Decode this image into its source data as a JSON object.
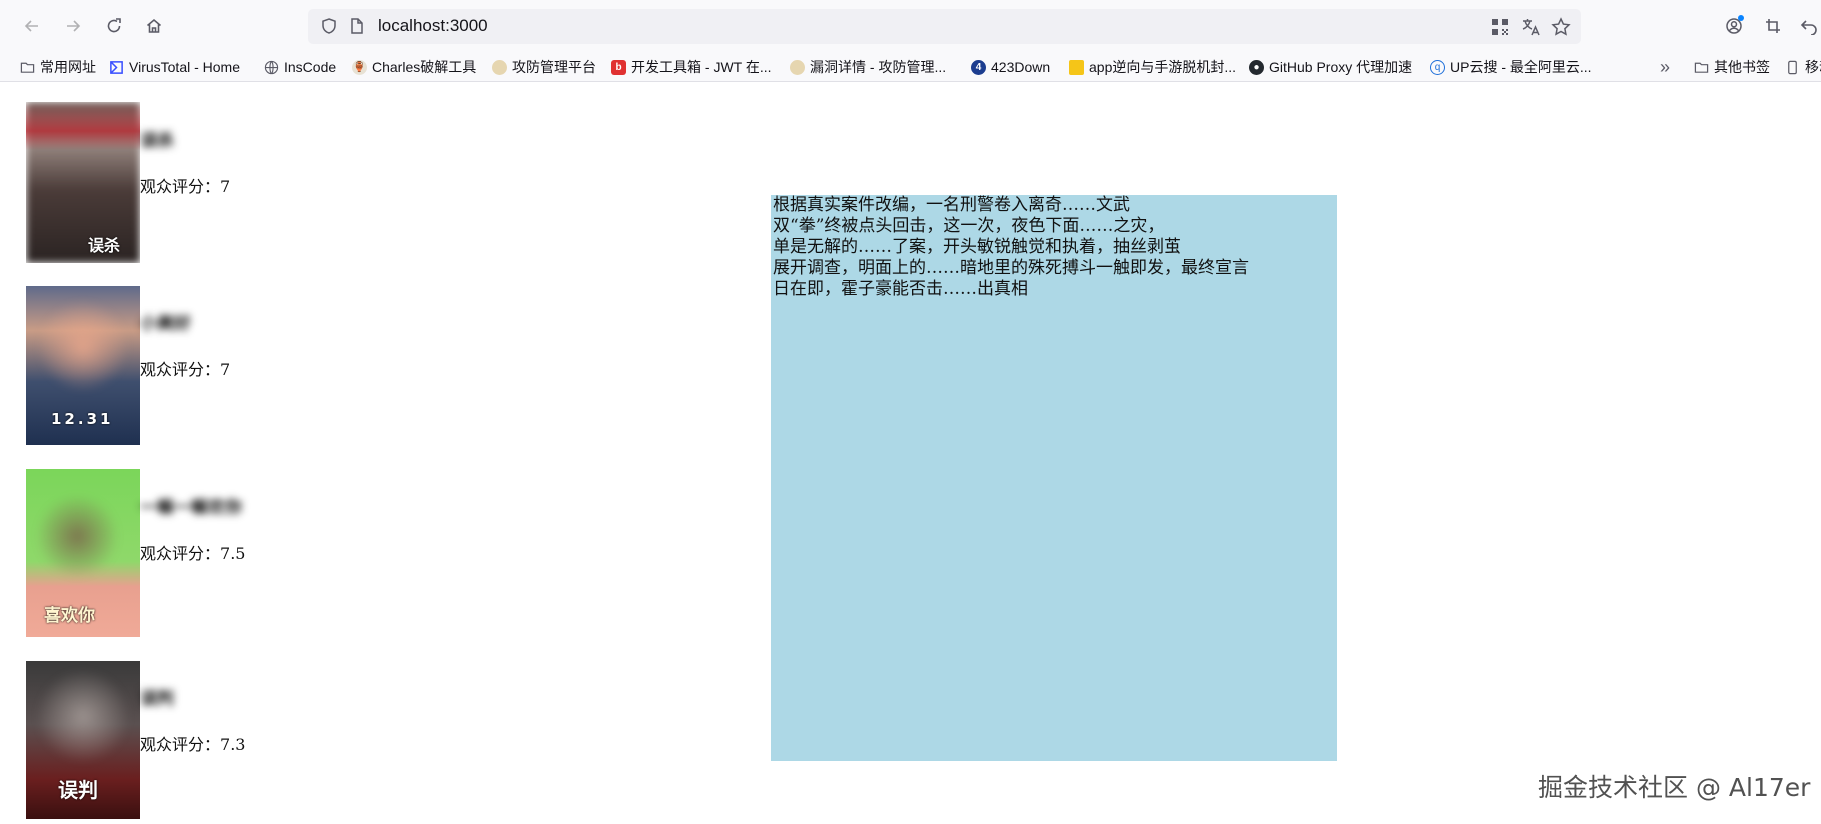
{
  "browser": {
    "url": "localhost:3000",
    "icons": [
      "back-icon",
      "forward-icon",
      "reload-icon",
      "home-icon",
      "shield-icon",
      "page-icon",
      "qr-code-icon",
      "translate-icon",
      "bookmark-star-icon",
      "account-icon",
      "extensions-icon",
      "undo-icon"
    ]
  },
  "bookmarks": {
    "items": [
      {
        "label": "常用网址",
        "icon": "folder-icon"
      },
      {
        "label": "VirusTotal - Home",
        "icon": "virustotal-icon"
      },
      {
        "label": "InsCode",
        "icon": "globe-icon"
      },
      {
        "label": "Charles破解工具",
        "icon": "charles-icon"
      },
      {
        "label": "攻防管理平台",
        "icon": "site-icon"
      },
      {
        "label": "开发工具箱 - JWT 在...",
        "icon": "devtools-icon"
      },
      {
        "label": "漏洞详情 - 攻防管理...",
        "icon": "site-icon"
      },
      {
        "label": "423Down",
        "icon": "download-site-icon"
      },
      {
        "label": "app逆向与手游脱机封...",
        "icon": "note-icon"
      },
      {
        "label": "GitHub Proxy 代理加速",
        "icon": "github-icon"
      },
      {
        "label": "UP云搜 - 最全阿里云...",
        "icon": "search-site-icon"
      }
    ],
    "overflow": "»",
    "other": "其他书签",
    "mobile": "移动"
  },
  "movies": [
    {
      "title": "误杀",
      "rating_label": "观众评分：",
      "rating": "7",
      "poster_text": "误杀"
    },
    {
      "title": "小美好",
      "rating_label": "观众评分：",
      "rating": "7",
      "poster_text": "12.31"
    },
    {
      "title": "一嘛一嘛欢你",
      "rating_label": "观众评分：",
      "rating": "7.5",
      "poster_text": "喜欢你"
    },
    {
      "title": "误判",
      "rating_label": "观众评分：",
      "rating": "7.3",
      "poster_text": "误判"
    }
  ],
  "detail": {
    "lines": [
      "根据真实案件改编，一名刑警卷入离奇……文武",
      "双“拳”终被点头回击，这一次，夜色下面……之灾，",
      "单是无解的……了案，开头敏锐触觉和执着，抽丝剥茧",
      "展开调查，明面上的……暗地里的殊死搏斗一触即发，最终宣言",
      "日在即，霍子豪能否击……出真相"
    ]
  },
  "watermark": "掘金技术社区 @ Al17er",
  "colors": {
    "detail_bg": "#add8e6",
    "toolbar_bg": "#f9f9fb",
    "urlbar_bg": "#f0f0f4"
  }
}
